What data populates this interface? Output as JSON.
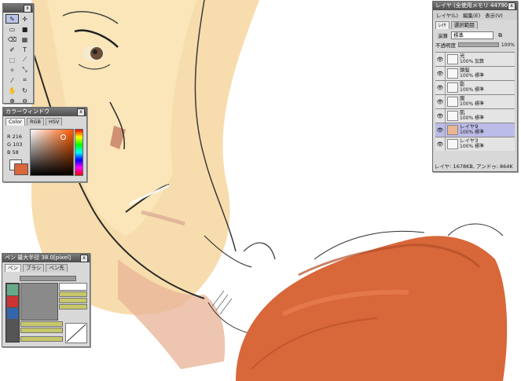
{
  "toolbox": {
    "close_label": "x"
  },
  "color_window": {
    "title": "カラーウィンドウ",
    "tabs": [
      "Color",
      "RGB",
      "HSV"
    ],
    "r_label": "R",
    "r_value": "216",
    "g_label": "G",
    "g_value": "103",
    "b_label": "B",
    "b_value": "58",
    "current_color": "#d8673a",
    "close_label": "x"
  },
  "pen_window": {
    "title": "ペン 最大半径 38.0[pixel]",
    "tabs": [
      "ペン",
      "ブラシ",
      "ペン先"
    ],
    "close_label": "x"
  },
  "layer_window": {
    "title": "レイヤ (全使用メモリ 44790...",
    "close_label": "x",
    "menu": [
      "レイヤ(L)",
      "編集(E)",
      "表示(V)"
    ],
    "tabs": [
      "ﾚｲﾔ",
      "選択範囲"
    ],
    "blend_label": "演算",
    "blend_value": "標準",
    "opacity_label": "不透明度",
    "opacity_value": "100%",
    "layers": [
      {
        "name": "光",
        "mode": "100% 加算"
      },
      {
        "name": "頭髪",
        "mode": "100% 標準"
      },
      {
        "name": "影",
        "mode": "100% 標準"
      },
      {
        "name": "服",
        "mode": "100% 標準"
      },
      {
        "name": "肌",
        "mode": "100% 標準"
      },
      {
        "name": "レイヤ9",
        "mode": "100% 標準"
      },
      {
        "name": "レイヤ3",
        "mode": "100% 標準"
      }
    ],
    "status": "レイヤ: 1678KB, アンドゥ: 864K"
  }
}
